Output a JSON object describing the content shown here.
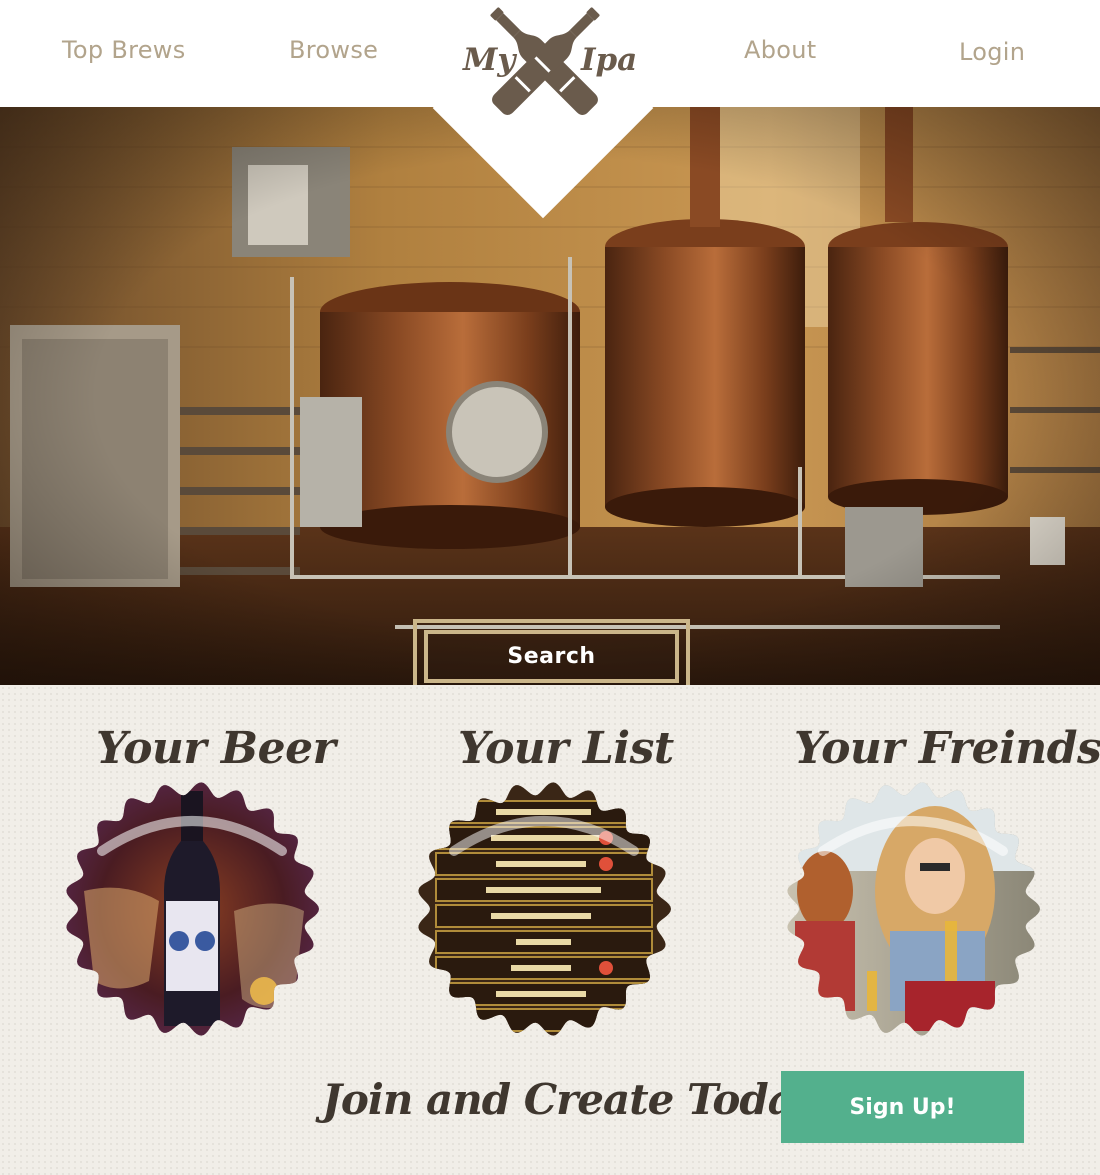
{
  "header": {
    "nav": {
      "top_brews": "Top Brews",
      "browse": "Browse",
      "about": "About",
      "login": "Login"
    },
    "logo": {
      "word_left": "My",
      "word_right": "Ipa",
      "icon": "crossed-bottles-icon"
    }
  },
  "hero": {
    "search_label": "Search",
    "image": "brewery-copper-kettles-photo"
  },
  "features": [
    {
      "title": "Your Beer",
      "image": "beer-bottle-glasses-photo"
    },
    {
      "title": "Your List",
      "image": "tap-list-board-photo"
    },
    {
      "title": "Your Freinds",
      "image": "friends-in-van-photo"
    }
  ],
  "cta": {
    "text": "Join and Create Today!",
    "button": "Sign Up!"
  },
  "colors": {
    "nav_text": "#b2a48c",
    "logo": "#6a5b4c",
    "search_border": "#cbb68a",
    "heading": "#3f372f",
    "signup_bg": "#53b08d",
    "section_bg": "#f1eee8"
  }
}
